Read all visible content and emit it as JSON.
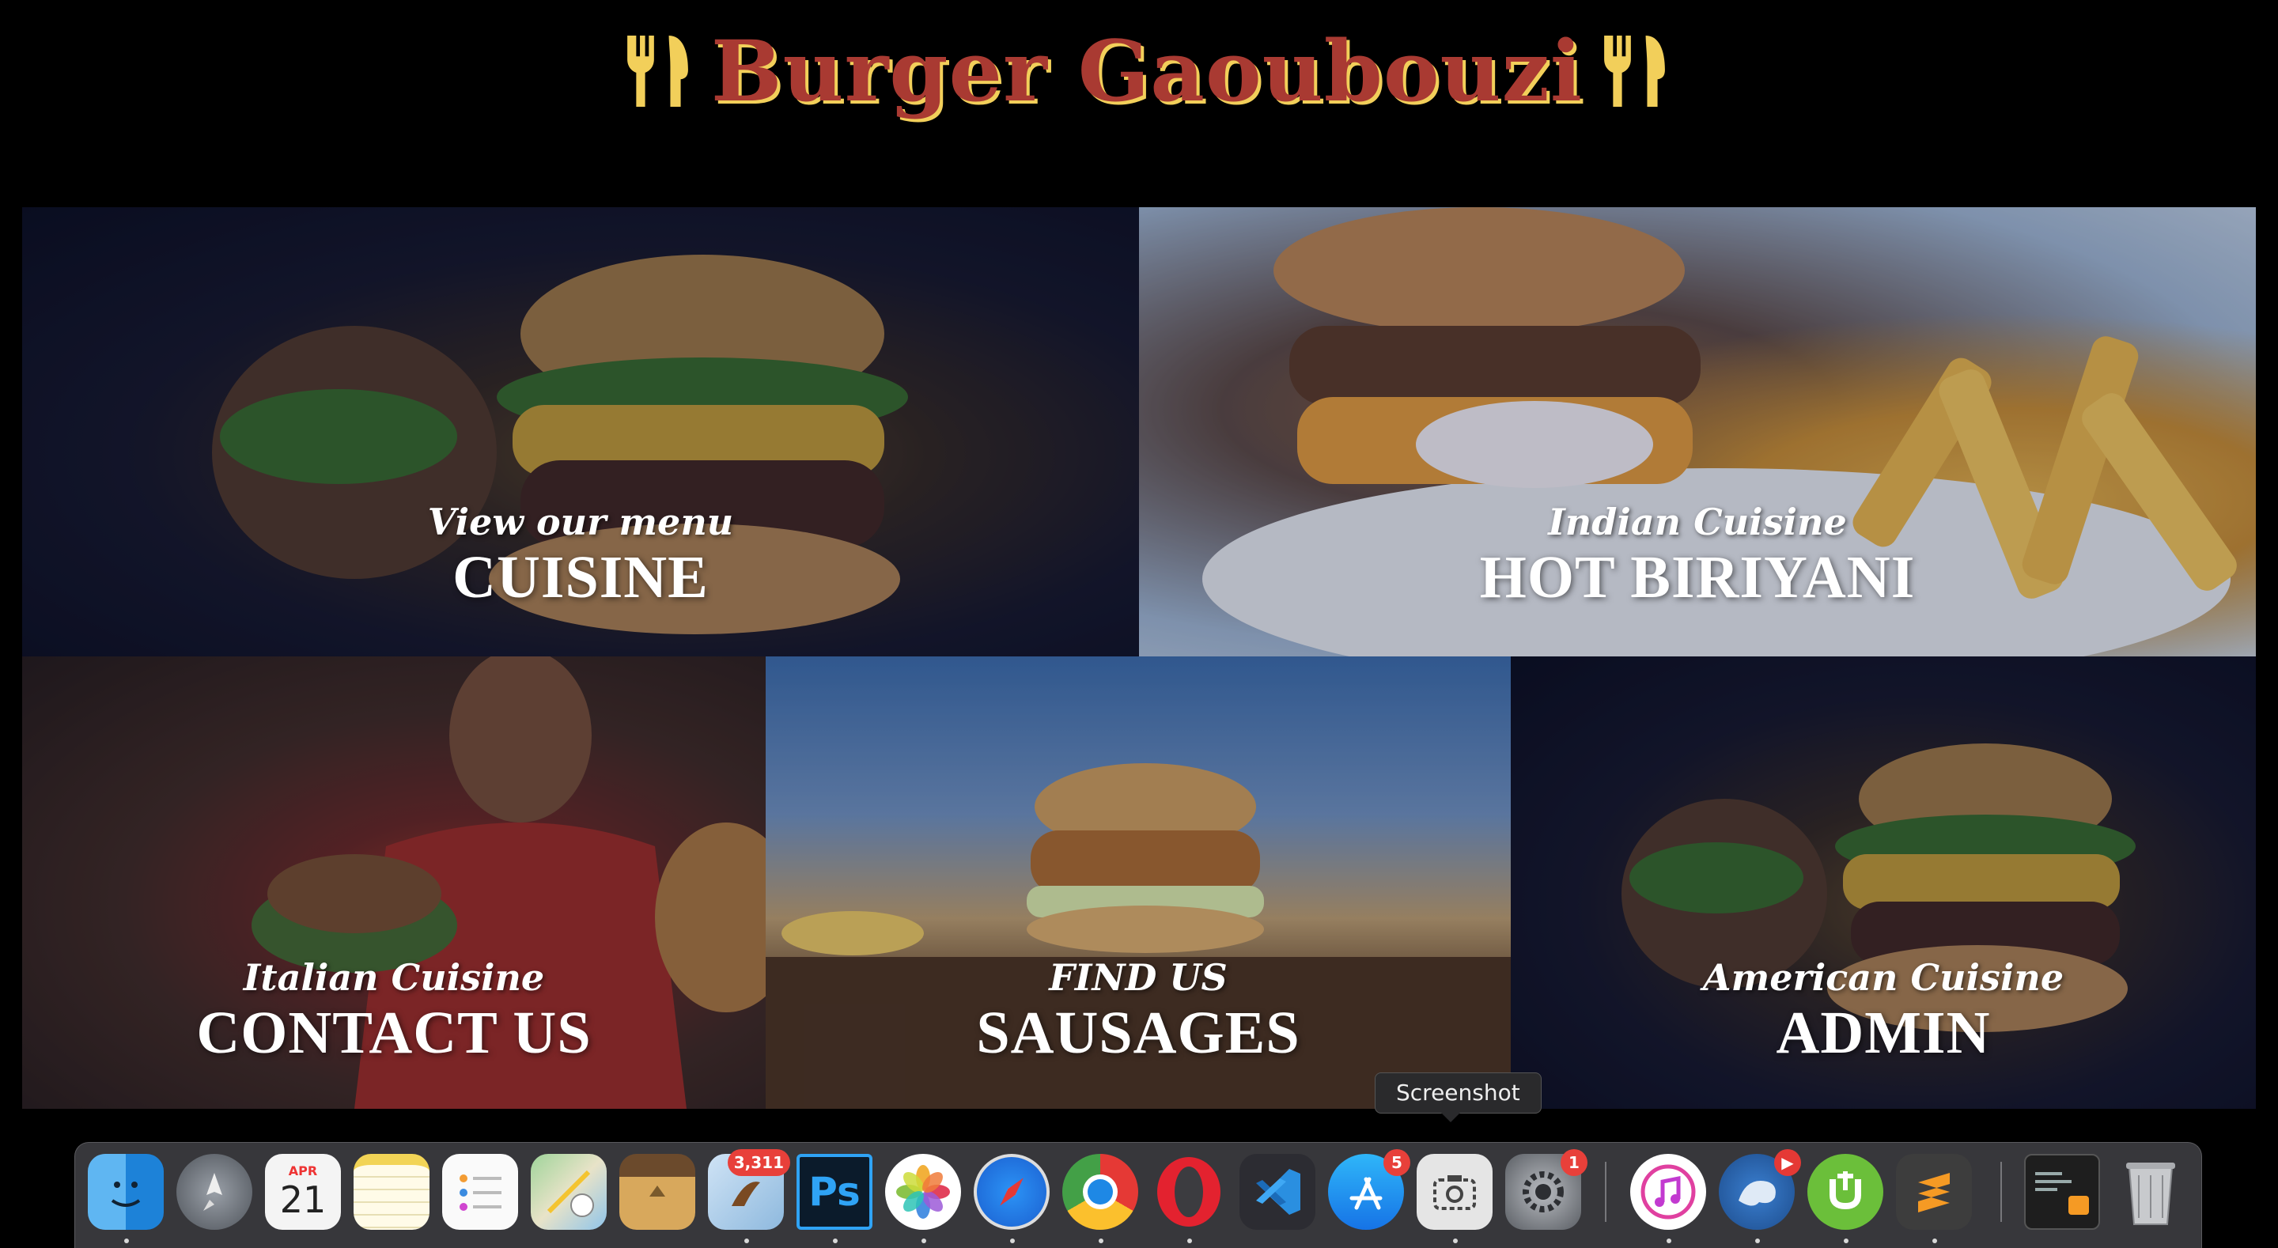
{
  "header": {
    "title": "Burger Gaoubouzi",
    "left_icon": "fork-knife-icon",
    "right_icon": "fork-knife-icon",
    "title_color": "#a93a32",
    "shadow_color": "#f2cf5a"
  },
  "tiles": [
    {
      "subtitle": "View our menu",
      "title": "CUISINE"
    },
    {
      "subtitle": "Indian Cuisine",
      "title": "HOT BIRIYANI"
    },
    {
      "subtitle": "Italian Cuisine",
      "title": "CONTACT US"
    },
    {
      "subtitle": "FIND US",
      "title": "SAUSAGES"
    },
    {
      "subtitle": "American Cuisine",
      "title": "ADMIN"
    }
  ],
  "tooltip": {
    "text": "Screenshot"
  },
  "dock": {
    "calendar": {
      "month": "APR",
      "day": "21"
    },
    "badges": {
      "mail": "3,311",
      "app_store": "5",
      "system_preferences": "1"
    },
    "apps": [
      "Finder",
      "Launchpad",
      "Calendar",
      "Notes",
      "Reminders",
      "Maps",
      "Archive Utility",
      "Mail",
      "Photoshop",
      "Photos",
      "Safari",
      "Chrome",
      "Opera",
      "VS Code",
      "App Store",
      "Screenshot",
      "System Preferences",
      "iTunes",
      "Sequel",
      "uTorrent",
      "Sublime Text",
      "Terminal",
      "Trash"
    ],
    "photoshop_label": "Ps"
  }
}
